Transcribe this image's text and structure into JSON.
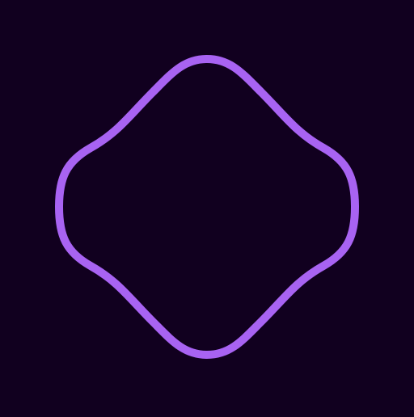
{
  "background_color": "#11001f",
  "shape": {
    "icon": "rounded-diamond-outline-icon",
    "stroke_color": "#a863f2"
  }
}
